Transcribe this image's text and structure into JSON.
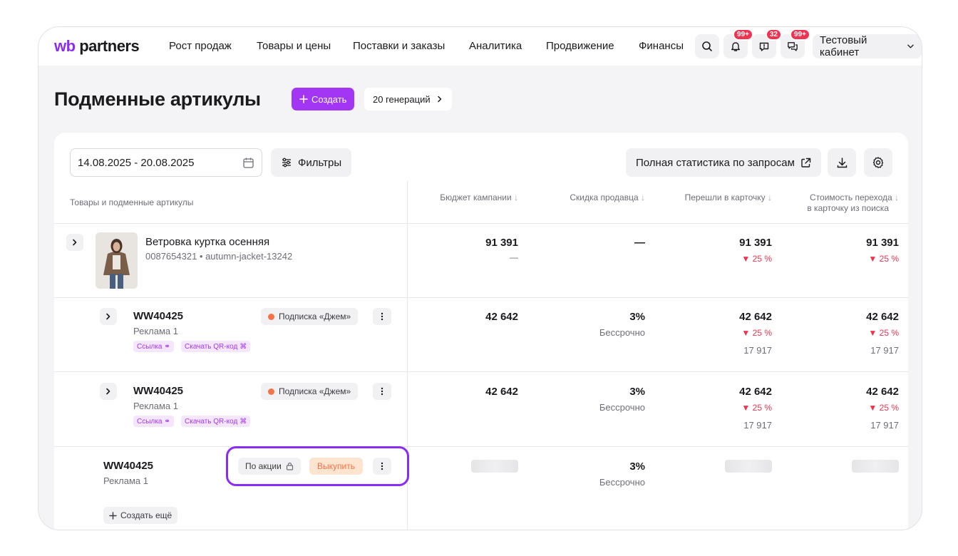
{
  "logo": {
    "wb": "wb",
    "partners": "partners"
  },
  "nav": [
    "Рост продаж",
    "Товары и цены",
    "Поставки и заказы",
    "Аналитика",
    "Продвижение",
    "Финансы"
  ],
  "badges": {
    "notifications": "99+",
    "feedback": "32",
    "chats": "99+"
  },
  "cabinet": "Тестовый кабинет",
  "header": {
    "title": "Подменные артикулы",
    "create": "Создать",
    "generations": "20 генераций"
  },
  "toolbar": {
    "date_range": "14.08.2025 - 20.08.2025",
    "filters": "Фильтры",
    "stats": "Полная статистика по запросам"
  },
  "columns": {
    "products": "Товары и подменные артикулы",
    "budget": "Бюджет кампании",
    "discount": "Скидка продавца",
    "clicks": "Перешли в карточку",
    "cost_line1": "Стоимость перехода",
    "cost_line2": "в карточку из поиска"
  },
  "product": {
    "name": "Ветровка куртка осенняя",
    "meta": "0087654321 • autumn-jacket-13242",
    "budget": "91 391",
    "budget_sub": "—",
    "discount": "—",
    "clicks": "91 391",
    "clicks_delta": "25 %",
    "cost": "91 391",
    "cost_delta": "25 %"
  },
  "rows": [
    {
      "sku": "WW40425",
      "campaign": "Реклама 1",
      "subscription": "Подписка «Джем»",
      "link": "Ссылка",
      "qr": "Скачать QR-код",
      "budget": "42 642",
      "discount": "3%",
      "discount_sub": "Бессрочно",
      "clicks": "42 642",
      "clicks_delta": "25 %",
      "clicks_sub": "17 917",
      "cost": "42 642",
      "cost_delta": "25 %",
      "cost_sub": "17 917"
    },
    {
      "sku": "WW40425",
      "campaign": "Реклама 1",
      "subscription": "Подписка «Джем»",
      "link": "Ссылка",
      "qr": "Скачать QR-код",
      "budget": "42 642",
      "discount": "3%",
      "discount_sub": "Бессрочно",
      "clicks": "42 642",
      "clicks_delta": "25 %",
      "clicks_sub": "17 917",
      "cost": "42 642",
      "cost_delta": "25 %",
      "cost_sub": "17 917"
    },
    {
      "sku": "WW40425",
      "campaign": "Реклама 1",
      "promo": "По акции",
      "buy": "Выкупить",
      "discount": "3%",
      "discount_sub": "Бессрочно"
    }
  ],
  "create_more": "Создать ещё",
  "colors": {
    "accent": "#a336f5",
    "negative": "#f0334f",
    "orange": "#f4744a"
  }
}
